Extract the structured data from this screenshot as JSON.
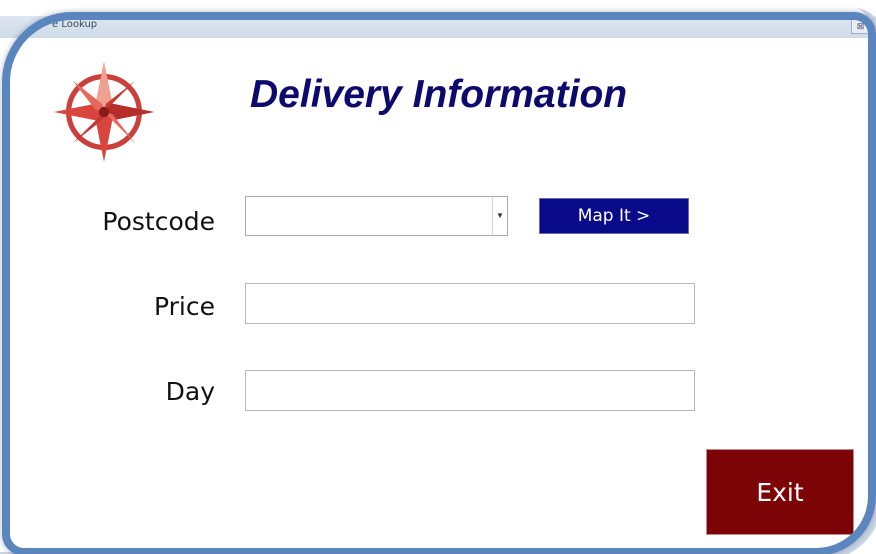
{
  "window": {
    "title": "Postcode Lookup",
    "visible_title": "e Lookup",
    "close_glyph": "⊠"
  },
  "form": {
    "heading": "Delivery Information",
    "postcode_label": "Postcode",
    "postcode_value": "",
    "price_label": "Price",
    "price_value": "",
    "day_label": "Day",
    "day_value": "",
    "map_button": "Map It >",
    "exit_button": "Exit"
  },
  "colors": {
    "heading": "#0d0a6e",
    "map_button_bg": "#080a8a",
    "exit_button_bg": "#7c0306",
    "frame": "#5b86bd"
  }
}
